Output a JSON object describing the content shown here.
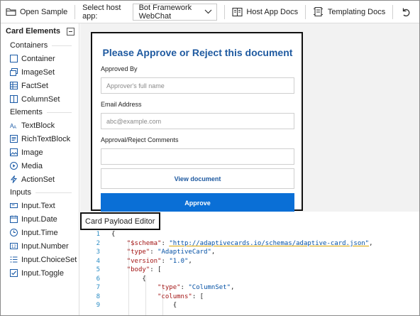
{
  "toolbar": {
    "open_sample": "Open Sample",
    "host_label": "Select host app:",
    "host_value": "Bot Framework WebChat",
    "host_docs": "Host App Docs",
    "templating_docs": "Templating Docs"
  },
  "sidebar": {
    "title": "Card Elements",
    "groups": [
      {
        "name": "Containers",
        "items": [
          "Container",
          "ImageSet",
          "FactSet",
          "ColumnSet"
        ]
      },
      {
        "name": "Elements",
        "items": [
          "TextBlock",
          "RichTextBlock",
          "Image",
          "Media",
          "ActionSet"
        ]
      },
      {
        "name": "Inputs",
        "items": [
          "Input.Text",
          "Input.Date",
          "Input.Time",
          "Input.Number",
          "Input.ChoiceSet",
          "Input.Toggle"
        ]
      }
    ]
  },
  "card": {
    "title": "Please Approve or Reject this document",
    "approved_by_label": "Approved By",
    "approved_by_placeholder": "Approver's full name",
    "email_label": "Email Address",
    "email_placeholder": "abc@example.com",
    "comments_label": "Approval/Reject Comments",
    "comments_value": "",
    "view_button": "View document",
    "approve_button": "Approve"
  },
  "editor": {
    "tab_label": "Card Payload Editor",
    "lines": [
      {
        "n": "1",
        "text": "{"
      },
      {
        "n": "2",
        "text": "    \"$schema\": \"http://adaptivecards.io/schemas/adaptive-card.json\","
      },
      {
        "n": "3",
        "text": "    \"type\": \"AdaptiveCard\","
      },
      {
        "n": "4",
        "text": "    \"version\": \"1.0\","
      },
      {
        "n": "5",
        "text": "    \"body\": ["
      },
      {
        "n": "6",
        "text": "        {"
      },
      {
        "n": "7",
        "text": "            \"type\": \"ColumnSet\","
      },
      {
        "n": "8",
        "text": "            \"columns\": ["
      },
      {
        "n": "9",
        "text": "                {"
      }
    ]
  },
  "colors": {
    "accent": "#0a6fd6",
    "title_blue": "#1f5aa0",
    "line_number": "#2b8cc4"
  }
}
